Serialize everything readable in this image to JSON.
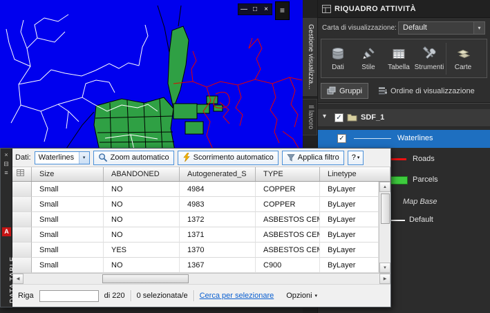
{
  "icons": {
    "chevron_down": "▾",
    "minimize": "—",
    "restore": "□",
    "close": "×",
    "menu": "≡",
    "check": "✓",
    "up": "▲",
    "down": "▼",
    "left": "◀",
    "right": "▶",
    "autohide": "⊟",
    "properties": "≡",
    "logo_letter": "A"
  },
  "colors": {
    "map_background": "#0000ee",
    "parcels_green": "#2fa044",
    "roads_red": "#e60000",
    "waterlines_white": "#ffffff",
    "selection_blue": "#1e6fc0",
    "panel_background": "#2e2e2e",
    "link_blue": "#0a5fd0"
  },
  "task_pane": {
    "title": "RIQUADRO ATTIVITÀ",
    "side_tabs": [
      {
        "label": "Gestione visualizza..."
      },
      {
        "label": "Il lavoro"
      }
    ],
    "display_map": {
      "label": "Carta di visualizzazione:",
      "value": "Default"
    },
    "toolbar_buttons": [
      {
        "label": "Dati"
      },
      {
        "label": "Stile"
      },
      {
        "label": "Tabella"
      },
      {
        "label": "Strumenti"
      },
      {
        "label": "Carte"
      }
    ],
    "groups_button": "Gruppi",
    "draw_order_button": "Ordine di visualizzazione",
    "layer_tree": {
      "root": "SDF_1",
      "layers": [
        {
          "name": "Waterlines",
          "checked": true,
          "selected": true
        },
        {
          "name": "Roads",
          "swatch": "red-line"
        },
        {
          "name": "Parcels",
          "swatch": "green-fill"
        },
        {
          "name": "Map Base",
          "style": "italic"
        },
        {
          "name": "Default",
          "swatch": "white-line"
        }
      ]
    }
  },
  "data_table": {
    "palette_title": "DATA TABLE",
    "toolbar": {
      "data_label": "Dati:",
      "data_value": "Waterlines",
      "zoom_button": "Zoom automatico",
      "scroll_button": "Scorrimento automatico",
      "filter_button": "Applica filtro",
      "help_button": "?"
    },
    "columns": [
      "Size",
      "ABANDONED",
      "Autogenerated_S",
      "TYPE",
      "Linetype"
    ],
    "rows": [
      [
        "Small",
        "NO",
        "4984",
        "COPPER",
        "ByLayer"
      ],
      [
        "Small",
        "NO",
        "4983",
        "COPPER",
        "ByLayer"
      ],
      [
        "Small",
        "NO",
        "1372",
        "ASBESTOS CEM...",
        "ByLayer"
      ],
      [
        "Small",
        "NO",
        "1371",
        "ASBESTOS CEM...",
        "ByLayer"
      ],
      [
        "Small",
        "YES",
        "1370",
        "ASBESTOS CEM...",
        "ByLayer"
      ],
      [
        "Small",
        "NO",
        "1367",
        "C900",
        "ByLayer"
      ]
    ],
    "status": {
      "row_label": "Riga",
      "row_value": "",
      "of_total": "di 220",
      "selected": "0 selezionata/e",
      "search_link": "Cerca per selezionare",
      "options": "Opzioni"
    }
  }
}
